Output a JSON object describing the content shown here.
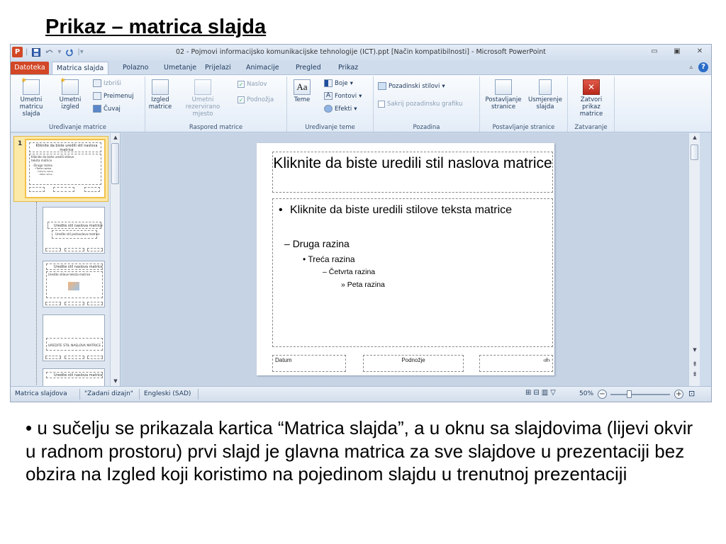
{
  "heading": "Prikaz – matrica slajda",
  "window": {
    "title": "02 - Pojmovi informacijsko komunikacijske tehnologije (ICT).ppt [Način kompatibilnosti] - Microsoft PowerPoint",
    "app_logo": "P"
  },
  "tabs": [
    {
      "label": "Datoteka"
    },
    {
      "label": "Matrica slajda",
      "active": true
    },
    {
      "label": "Polazno"
    },
    {
      "label": "Umetanje"
    },
    {
      "label": "Prijelazi"
    },
    {
      "label": "Animacije"
    },
    {
      "label": "Pregled"
    },
    {
      "label": "Prikaz"
    }
  ],
  "ribbon": {
    "edit_master": {
      "label": "Uređivanje matrice",
      "insert_master": "Umetni matricu slajda",
      "insert_layout": "Umetni izgled",
      "delete": "Izbriši",
      "rename": "Preimenuj",
      "preserve": "Čuvaj"
    },
    "layout": {
      "label": "Raspored matrice",
      "master_layout": "Izgled matrice",
      "insert_placeholder": "Umetni rezervirano mjesto",
      "title": "Naslov",
      "footers": "Podnožja"
    },
    "theme": {
      "label": "Uređivanje teme",
      "themes": "Teme",
      "colors": "Boje",
      "fonts": "Fontovi",
      "effects": "Efekti"
    },
    "background": {
      "label": "Pozadina",
      "styles": "Pozadinski stilovi",
      "hide": "Sakrij pozadinsku grafiku"
    },
    "page_setup": {
      "label": "Postavljanje stranice",
      "setup": "Postavljanje stranice",
      "orientation": "Usmjerenje slajda"
    },
    "close": {
      "label": "Zatvaranje",
      "close_view": "Zatvori prikaz matrice"
    }
  },
  "thumbnails": {
    "first_number": "1",
    "main_title": "Kliknite da biste uredili stil naslova matrice",
    "main_body": [
      "Kliknite da biste uredili stilove teksta matrice",
      "–Druga razina",
      "•Treća razina",
      "–Četvrta razina",
      "»Peta razina"
    ],
    "t2_title": "Uredite stil naslova matrice",
    "t2_sub": "Uredite stil podnaslova matrice",
    "t3_title": "Uredite stil naslova matrice",
    "t3_body": "Uredite stilove teksta matrice",
    "t4_title": "UREDITE STIL NASLOVA MATRICE",
    "t5_title": "Uredite stil naslova matrice"
  },
  "slide": {
    "title": "Kliknite da biste uredili stil naslova matrice",
    "level1": "Kliknite da biste uredili stilove teksta matrice",
    "level2": "Druga razina",
    "level3": "Treća razina",
    "level4": "Četvrta  razina",
    "level5": "Peta razina",
    "footer_date": "Datum",
    "footer_center": "Podnožje",
    "footer_number": "‹#›"
  },
  "statusbar": {
    "view": "Matrica slajdova",
    "theme": "\"Zadani dizajn\"",
    "language": "Engleski (SAD)",
    "zoom": "50%",
    "zoom_fraction": 0.5
  },
  "caption": "• u sučelju se prikazala kartica “Matrica slajda”, a u oknu sa slajdovima (lijevi okvir u radnom prostoru) prvi slajd je glavna matrica za sve slajdove u prezentaciji bez obzira na Izgled koji koristimo na pojedinom slajdu u trenutnoj prezentaciji",
  "colors": {
    "file_tab": "#d24726",
    "ribbon": "#e3ecf7",
    "selection": "#fce9a8"
  },
  "icons": [
    "powerpoint-logo-icon",
    "save-icon",
    "undo-icon",
    "redo-icon",
    "minimize-icon",
    "restore-icon",
    "close-icon",
    "help-icon",
    "zoom-in-icon",
    "zoom-out-icon",
    "fit-window-icon"
  ]
}
